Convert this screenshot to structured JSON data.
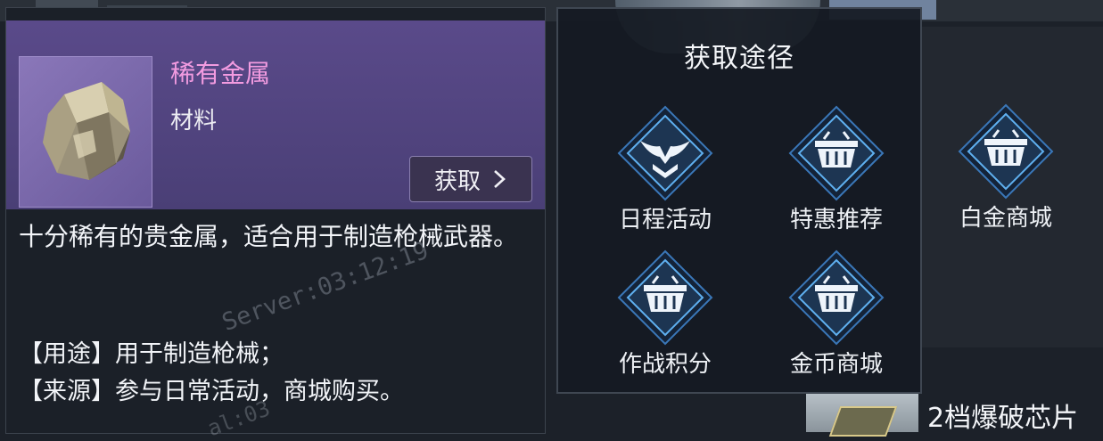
{
  "item": {
    "name": "稀有金属",
    "type": "材料",
    "obtain_button": "获取",
    "description": "十分稀有的贵金属，适合用于制造枪械武器。",
    "usage": "【用途】用于制造枪械；",
    "source": "【来源】参与日常活动，商城购买。",
    "icon": "metal-ore-icon"
  },
  "watermark": {
    "main": "Server:03:12:19",
    "partial": "al:03"
  },
  "source_panel": {
    "title": "获取途径",
    "methods": [
      {
        "label": "日程活动",
        "icon": "eagle-emblem-icon"
      },
      {
        "label": "特惠推荐",
        "icon": "shopping-basket-icon"
      },
      {
        "label": "白金商城",
        "icon": "shopping-basket-icon"
      },
      {
        "label": "作战积分",
        "icon": "shopping-basket-icon"
      },
      {
        "label": "金币商城",
        "icon": "shopping-basket-icon"
      }
    ]
  },
  "background": {
    "bottom_item_label": "2档爆破芯片"
  },
  "colors": {
    "rare_name": "#f29be0",
    "header_purple": "#5a4a8a",
    "diamond_fill": "#1d3552",
    "diamond_glow": "#4fa0e8"
  }
}
